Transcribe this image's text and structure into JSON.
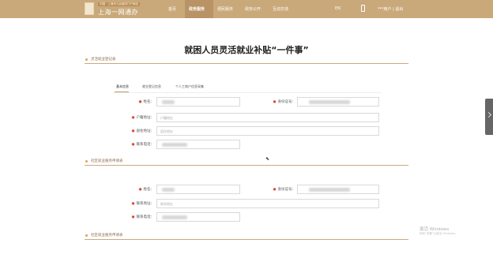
{
  "header": {
    "logo_small": "中国 · 上海市人民政府门户网站",
    "logo_big": "上海一网通办",
    "nav": [
      "首页",
      "政务服务",
      "便民服务",
      "政务公开",
      "互动交流"
    ],
    "active_nav_index": 1,
    "lang": "EN",
    "user": "***用户 | 退出"
  },
  "page": {
    "title": "就困人员灵活就业补贴“一件事”"
  },
  "section1": {
    "title": "灵活就业登记表",
    "tabs": [
      "基本信息",
      "就业登记信息",
      "个人工商户信息采集"
    ],
    "fields": {
      "name_label": "姓名：",
      "id_label": "身份证号：",
      "household_label": "户籍地址：",
      "household_placeholder": "户籍地址",
      "residence_label": "居住地址：",
      "residence_placeholder": "居住地址",
      "phone_label": "联系电话："
    }
  },
  "section2": {
    "title": "社区就业服务申请表",
    "fields": {
      "name_label": "姓名：",
      "id_label": "身份证号：",
      "address_label": "联系地址：",
      "address_placeholder": "联系地址",
      "phone_label": "联系电话："
    }
  },
  "section3": {
    "title": "社区就业服务申请表"
  },
  "watermark": {
    "line1": "激活 Windows",
    "line2": "转到“设置”以激活 Windows。"
  },
  "icons": {
    "phone": "phone-icon",
    "expand": "chevron-right-icon",
    "cursor": "mouse-cursor-icon"
  },
  "colors": {
    "brand": "#c9a97a",
    "accent": "#e0a64a",
    "required": "#e04a3a"
  }
}
